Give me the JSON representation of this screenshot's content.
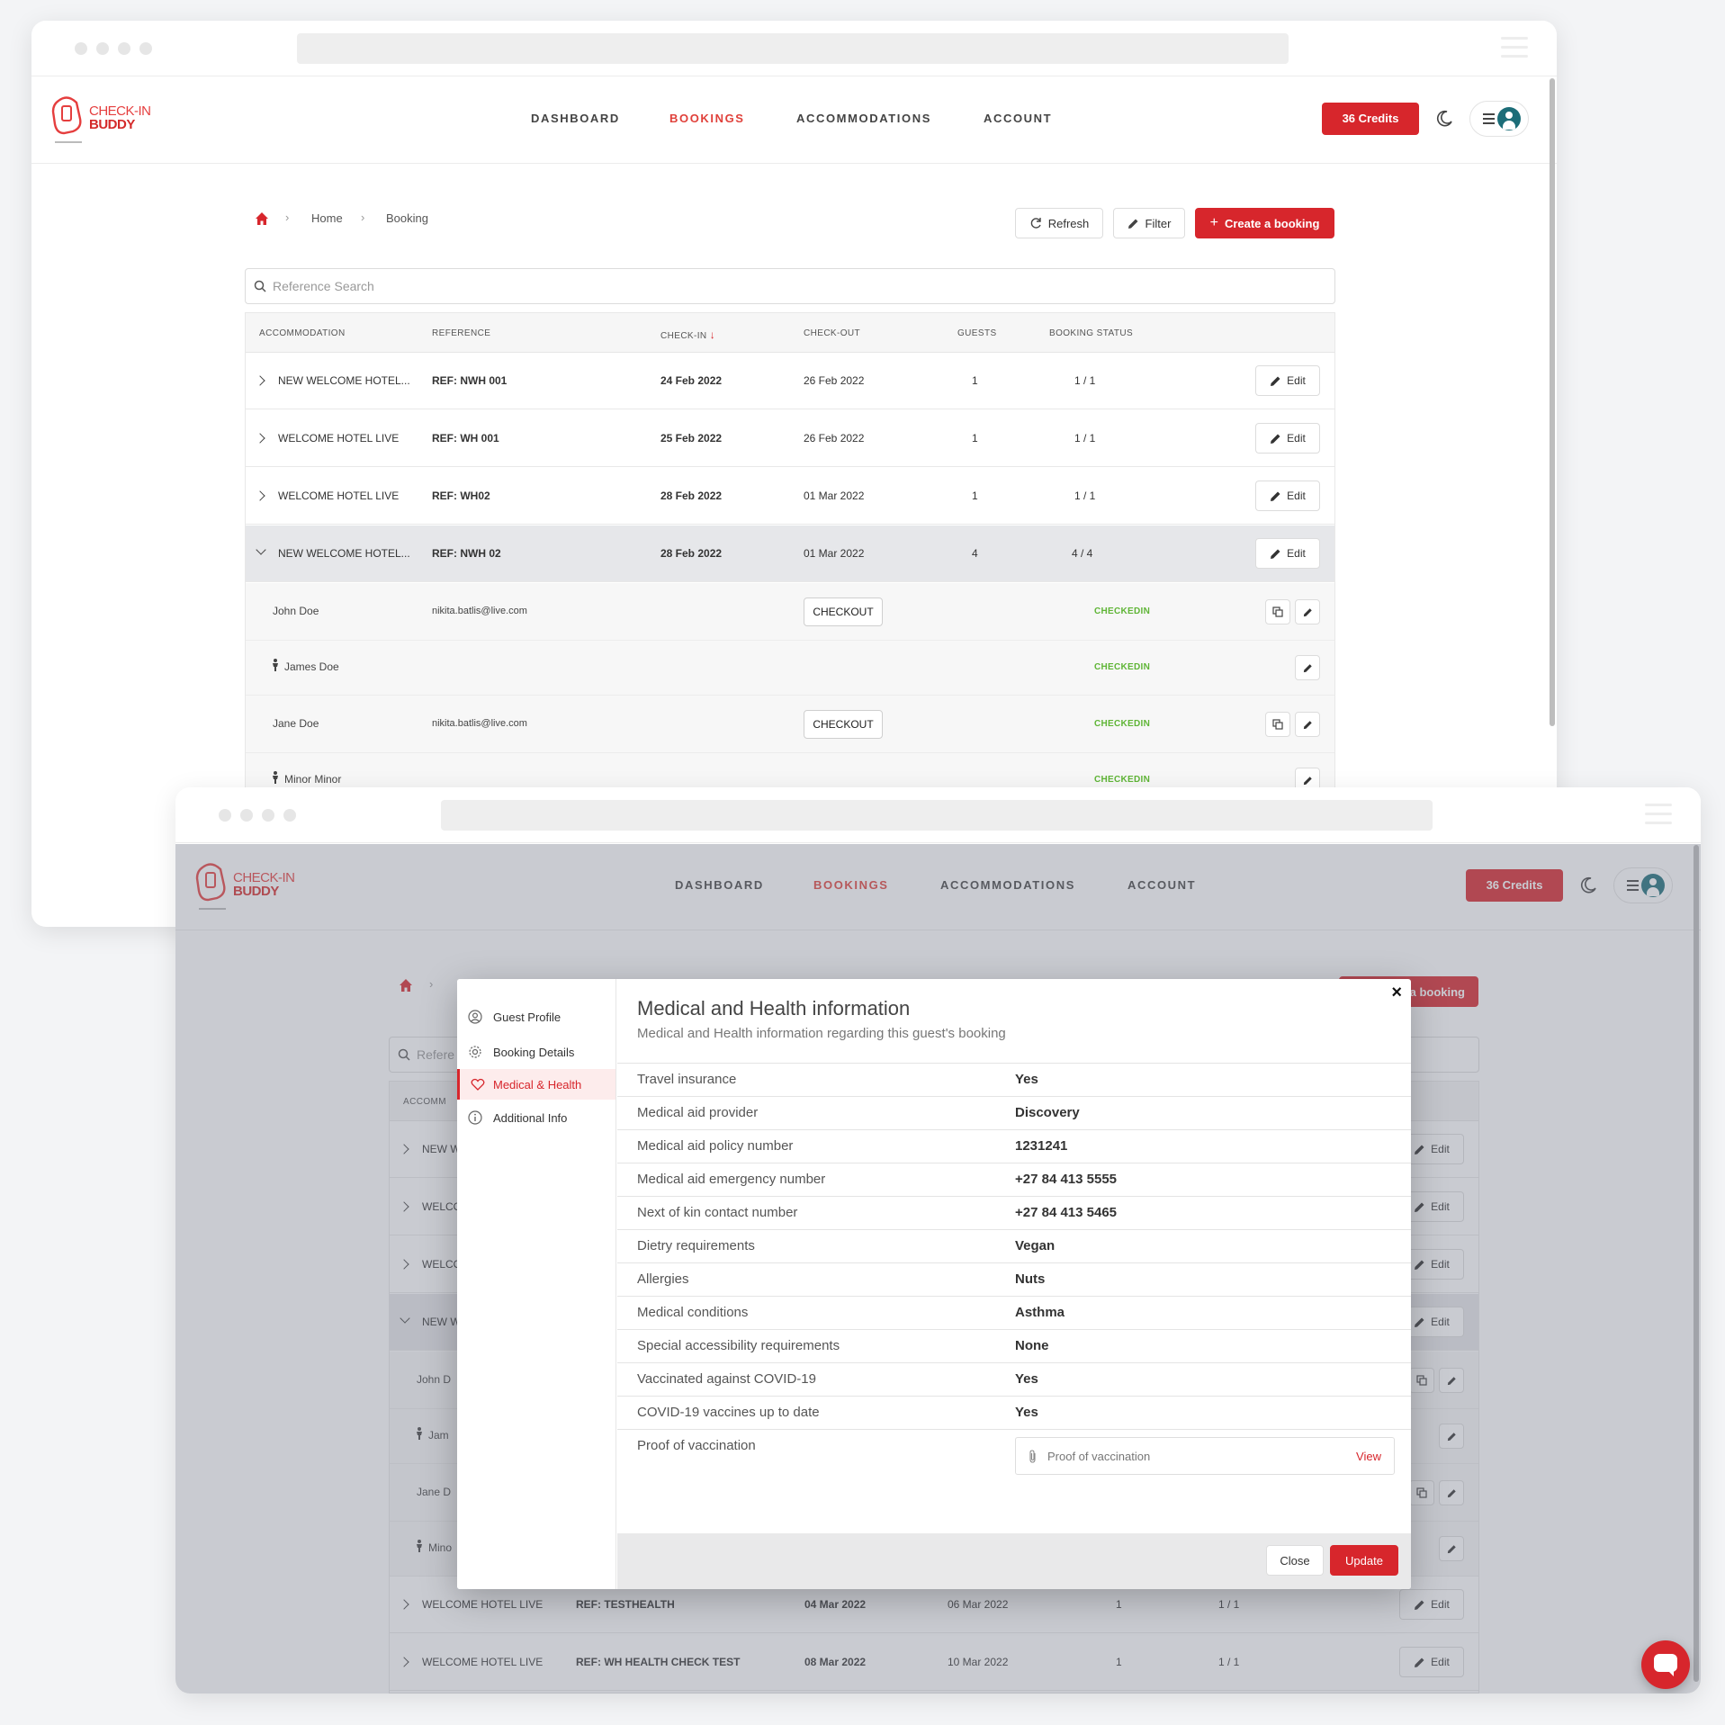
{
  "brand": {
    "line1": "CHECK-IN",
    "line2": "BUDDY"
  },
  "nav": {
    "dashboard": "DASHBOARD",
    "bookings": "BOOKINGS",
    "accommodations": "ACCOMMODATIONS",
    "account": "ACCOUNT"
  },
  "credits": "36 Credits",
  "breadcrumb": {
    "home": "Home",
    "current": "Booking"
  },
  "actions": {
    "refresh": "Refresh",
    "filter": "Filter",
    "create": "Create a booking",
    "create_partial": "a booking"
  },
  "search": {
    "placeholder": "Reference Search",
    "partial": "Refere"
  },
  "table": {
    "headers": {
      "accommodation": "ACCOMMODATION",
      "reference": "REFERENCE",
      "checkin": "CHECK-IN",
      "checkout": "CHECK-OUT",
      "guests": "GUESTS",
      "status": "BOOKING STATUS"
    },
    "header_partial": "ACCOMM",
    "edit": "Edit",
    "rows": [
      {
        "accommodation": "NEW WELCOME HOTEL...",
        "reference": "REF: NWH 001",
        "checkin": "24 Feb 2022",
        "checkout": "26 Feb 2022",
        "guests": "1",
        "status": "1 / 1",
        "partial": "NEW W"
      },
      {
        "accommodation": "WELCOME HOTEL LIVE",
        "reference": "REF: WH 001",
        "checkin": "25 Feb 2022",
        "checkout": "26 Feb 2022",
        "guests": "1",
        "status": "1 / 1",
        "partial": "WELCO"
      },
      {
        "accommodation": "WELCOME HOTEL LIVE",
        "reference": "REF: WH02",
        "checkin": "28 Feb 2022",
        "checkout": "01 Mar 2022",
        "guests": "1",
        "status": "1 / 1",
        "partial": "WELCO"
      },
      {
        "accommodation": "NEW WELCOME HOTEL...",
        "reference": "REF: NWH 02",
        "checkin": "28 Feb 2022",
        "checkout": "01 Mar 2022",
        "guests": "4",
        "status": "4 / 4",
        "partial": "NEW W"
      }
    ],
    "guests": [
      {
        "name": "John Doe",
        "email": "nikita.batlis@live.com",
        "checkout": "CHECKOUT",
        "status": "CHECKEDIN",
        "partial": "John D"
      },
      {
        "name": "James Doe",
        "status": "CHECKEDIN",
        "partial": "Jam"
      },
      {
        "name": "Jane Doe",
        "email": "nikita.batlis@live.com",
        "checkout": "CHECKOUT",
        "status": "CHECKEDIN",
        "partial": "Jane D"
      },
      {
        "name": "Minor Minor",
        "status": "CHECKEDIN",
        "partial": "Mino"
      }
    ],
    "more_rows": [
      {
        "accommodation": "WELCOME HOTEL LIVE",
        "reference": "REF: TESTHEALTH",
        "checkin": "04 Mar 2022",
        "checkout": "06 Mar 2022",
        "guests": "1",
        "status": "1 / 1"
      },
      {
        "accommodation": "WELCOME HOTEL LIVE",
        "reference": "REF: WH HEALTH CHECK TEST",
        "checkin": "08 Mar 2022",
        "checkout": "10 Mar 2022",
        "guests": "1",
        "status": "1 / 1"
      }
    ]
  },
  "modal": {
    "menu": [
      "Guest Profile",
      "Booking Details",
      "Medical & Health",
      "Additional Info"
    ],
    "title": "Medical and Health information",
    "subtitle": "Medical and Health information regarding this guest's booking",
    "fields": [
      {
        "label": "Travel insurance",
        "value": "Yes"
      },
      {
        "label": "Medical aid provider",
        "value": "Discovery"
      },
      {
        "label": "Medical aid policy number",
        "value": "1231241"
      },
      {
        "label": "Medical aid emergency number",
        "value": "+27 84 413 5555"
      },
      {
        "label": "Next of kin contact number",
        "value": "+27 84 413 5465"
      },
      {
        "label": "Dietry requirements",
        "value": "Vegan"
      },
      {
        "label": "Allergies",
        "value": "Nuts"
      },
      {
        "label": "Medical conditions",
        "value": "Asthma"
      },
      {
        "label": "Special accessibility requirements",
        "value": "None"
      },
      {
        "label": "Vaccinated against COVID-19",
        "value": "Yes"
      },
      {
        "label": "COVID-19 vaccines up to date",
        "value": "Yes"
      }
    ],
    "proof": {
      "label": "Proof of vaccination",
      "file_label": "Proof of vaccination",
      "view": "View"
    },
    "close": "Close",
    "update": "Update",
    "close_icon": "×"
  },
  "colors": {
    "brand_red": "#d7262c",
    "checkedin_green": "#5fb536"
  }
}
